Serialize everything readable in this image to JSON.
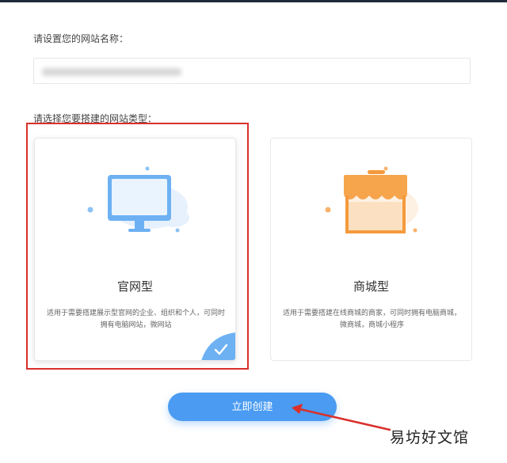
{
  "form": {
    "name_label": "请设置您的网站名称：",
    "name_value": "",
    "type_label": "请选择您要搭建的网站类型："
  },
  "cards": [
    {
      "title": "官网型",
      "description": "适用于需要搭建展示型官网的企业、组织和个人，可同时拥有电脑网站，微网站",
      "selected": true,
      "icon": "monitor-icon"
    },
    {
      "title": "商城型",
      "description": "适用于需要搭建在线商城的商家，可同时拥有电脑商城，微商城，商城小程序",
      "selected": false,
      "icon": "storefront-icon"
    }
  ],
  "actions": {
    "create_label": "立即创建"
  },
  "watermark": {
    "text": "易坊好文馆"
  },
  "colors": {
    "accent": "#4a9bf1",
    "highlight": "#d9302b",
    "shop_orange": "#f59a3c"
  }
}
